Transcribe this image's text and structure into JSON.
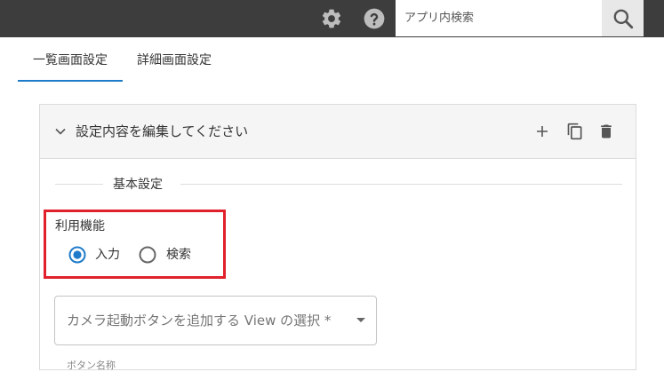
{
  "header": {
    "search_placeholder": "アプリ内検索",
    "icons": [
      "gear-icon",
      "help-icon",
      "search-icon"
    ]
  },
  "tabs": [
    {
      "label": "一覧画面設定",
      "active": true
    },
    {
      "label": "詳細画面設定",
      "active": false
    }
  ],
  "panel": {
    "title": "設定内容を編集してください",
    "section_title": "基本設定",
    "field_label": "利用機能",
    "radio_options": [
      {
        "label": "入力",
        "selected": true
      },
      {
        "label": "検索",
        "selected": false
      }
    ],
    "select_placeholder": "カメラ起動ボタンを追加する View の選択 *",
    "next_field_label": "ボタン名称"
  },
  "colors": {
    "topbar": "#3d3d3d",
    "accent": "#1e7bc9",
    "highlight": "#e0202a"
  }
}
